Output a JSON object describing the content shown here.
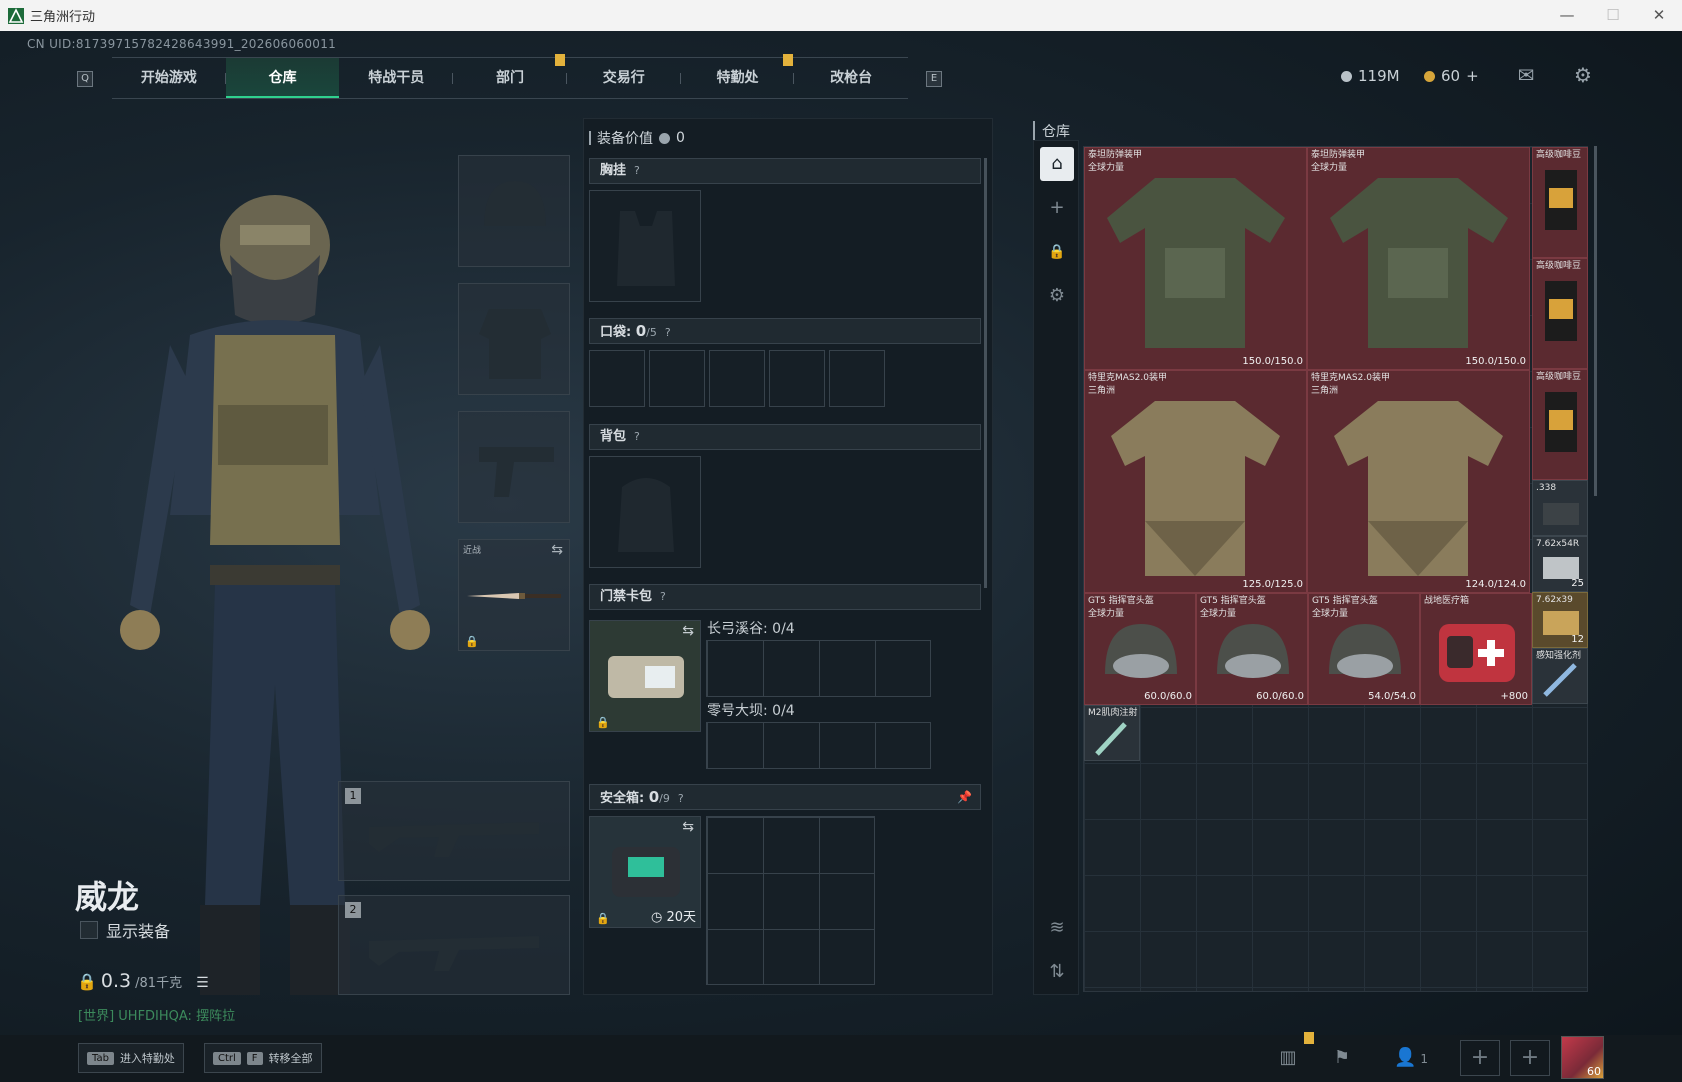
{
  "window": {
    "title": "三角洲行动"
  },
  "account": {
    "uid": "CN UID:8173971578242864399­1_202606060011"
  },
  "nav": {
    "key_left": "Q",
    "key_right": "E",
    "tabs": [
      "开始游戏",
      "仓库",
      "特战干员",
      "部门",
      "交易行",
      "特勤处",
      "改枪台"
    ]
  },
  "currency": {
    "coins": "119M",
    "tickets": "60",
    "plus": "+"
  },
  "character": {
    "name": "威龙",
    "show_equipment": "显示装备",
    "weight": "0.3",
    "weight_max": "/81千克",
    "chat": "[世界] UHFDIHQA: 摆阵拉"
  },
  "equip_slots": {
    "melee_label": "近战",
    "weapon1": "1",
    "weapon2": "2"
  },
  "loadout": {
    "value_label": "装备价值",
    "value": "0",
    "chest_rig": "胸挂",
    "pockets": "口袋:",
    "pockets_count": "0",
    "pockets_max": "/5",
    "backpack": "背包",
    "keycard_case": "门禁卡包",
    "key_longbow": "长弓溪谷: 0/4",
    "key_zero_dam": "零号大坝: 0/4",
    "safebox": "安全箱:",
    "safebox_count": "0",
    "safebox_max": "/9",
    "safebox_days": "20天",
    "help_mark": "?"
  },
  "warehouse": {
    "title": "仓库",
    "items": [
      {
        "name": "泰坦防弹装甲",
        "sub": "全球力量",
        "dur": "150.0/150.0"
      },
      {
        "name": "泰坦防弹装甲",
        "sub": "全球力量",
        "dur": "150.0/150.0"
      },
      {
        "name": "特里克MAS2.0装甲",
        "sub": "三角洲",
        "dur": "125.0/125.0"
      },
      {
        "name": "特里克MAS2.0装甲",
        "sub": "三角洲",
        "dur": "124.0/124.0"
      },
      {
        "name": "GT5 指挥官头盔",
        "sub": "全球力量",
        "dur": "60.0/60.0"
      },
      {
        "name": "GT5 指挥官头盔",
        "sub": "全球力量",
        "dur": "60.0/60.0"
      },
      {
        "name": "GT5 指挥官头盔",
        "sub": "全球力量",
        "dur": "54.0/54.0"
      },
      {
        "name": "战地医疗箱",
        "sub": "",
        "dur": "+800"
      },
      {
        "name": "M2肌肉注射",
        "sub": "",
        "dur": ""
      }
    ],
    "small_items": [
      {
        "name": "高级咖啡豆",
        "qty": ""
      },
      {
        "name": "高级咖啡豆",
        "qty": ""
      },
      {
        "name": "高级咖啡豆",
        "qty": ""
      },
      {
        "name": ".338",
        "qty": ""
      },
      {
        "name": "7.62x54R",
        "qty": "25"
      },
      {
        "name": "7.62x39",
        "qty": "12"
      },
      {
        "name": "感知强化剂",
        "qty": ""
      }
    ]
  },
  "bottom": {
    "tab_key": "Tab",
    "tab_hint": "进入特勤处",
    "ctrl_key": "Ctrl",
    "f_key": "F",
    "transfer_hint": "转移全部",
    "friends": "1",
    "avatar_level": "60"
  },
  "colors": {
    "accent": "#2fd18e",
    "rare_bg": "#5b2a30",
    "marker": "#e3b23c"
  }
}
